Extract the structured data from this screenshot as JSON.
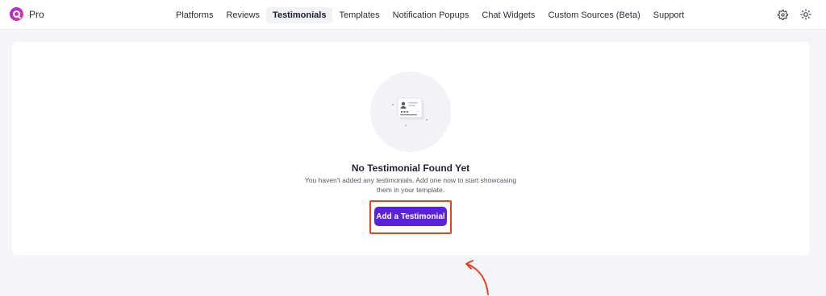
{
  "brand": {
    "name": "Pro"
  },
  "nav": [
    {
      "label": "Platforms",
      "active": false
    },
    {
      "label": "Reviews",
      "active": false
    },
    {
      "label": "Testimonials",
      "active": true
    },
    {
      "label": "Templates",
      "active": false
    },
    {
      "label": "Notification Popups",
      "active": false
    },
    {
      "label": "Chat Widgets",
      "active": false
    },
    {
      "label": "Custom Sources (Beta)",
      "active": false
    },
    {
      "label": "Support",
      "active": false
    }
  ],
  "header_icons": [
    "gear-icon",
    "sun-icon"
  ],
  "empty_state": {
    "title": "No Testimonial Found Yet",
    "description": "You haven't added any testimonials. Add one now to start showcasing them in your template.",
    "cta_label": "Add a Testimonial"
  },
  "colors": {
    "accent": "#5b23d8",
    "highlight": "#e8431b",
    "brand_gradient_start": "#a32bd8",
    "brand_gradient_end": "#e03ca0"
  }
}
